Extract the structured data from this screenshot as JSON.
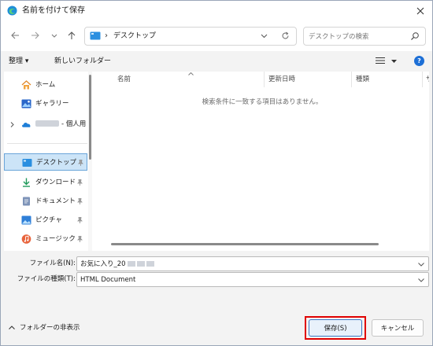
{
  "window": {
    "title": "名前を付けて保存"
  },
  "navbar": {
    "address_path": "デスクトップ",
    "address_separator": "›",
    "search_placeholder": "デスクトップの検索"
  },
  "toolbar": {
    "organize_label": "整理 ▾",
    "new_folder_label": "新しいフォルダー",
    "help_label": "?"
  },
  "sidebar": {
    "items": [
      {
        "label": "ホーム",
        "icon": "home-icon"
      },
      {
        "label": "ギャラリー",
        "icon": "gallery-icon"
      },
      {
        "label": "- 個人用",
        "icon": "onedrive-cloud-icon"
      },
      {
        "label": "デスクトップ",
        "icon": "desktop-folder-icon",
        "selected": true,
        "pinned": true
      },
      {
        "label": "ダウンロード",
        "icon": "download-icon",
        "pinned": true
      },
      {
        "label": "ドキュメント",
        "icon": "document-icon",
        "pinned": true
      },
      {
        "label": "ピクチャ",
        "icon": "pictures-icon",
        "pinned": true
      },
      {
        "label": "ミュージック",
        "icon": "music-icon",
        "pinned": true
      }
    ]
  },
  "file_list": {
    "columns": [
      "名前",
      "更新日時",
      "種類",
      "サ"
    ],
    "empty_message": "検索条件に一致する項目はありません。"
  },
  "form": {
    "filename_label": "ファイル名(N):",
    "filename_value": "お気に入り_20",
    "filetype_label": "ファイルの種類(T):",
    "filetype_value": "HTML Document"
  },
  "bottom": {
    "hide_folders_label": "フォルダーの非表示",
    "save_label": "保存(S)",
    "cancel_label": "キャンセル"
  },
  "colors": {
    "accent": "#1d6fd6",
    "selection_bg": "#cce4f7",
    "highlight_frame": "#e00000"
  }
}
